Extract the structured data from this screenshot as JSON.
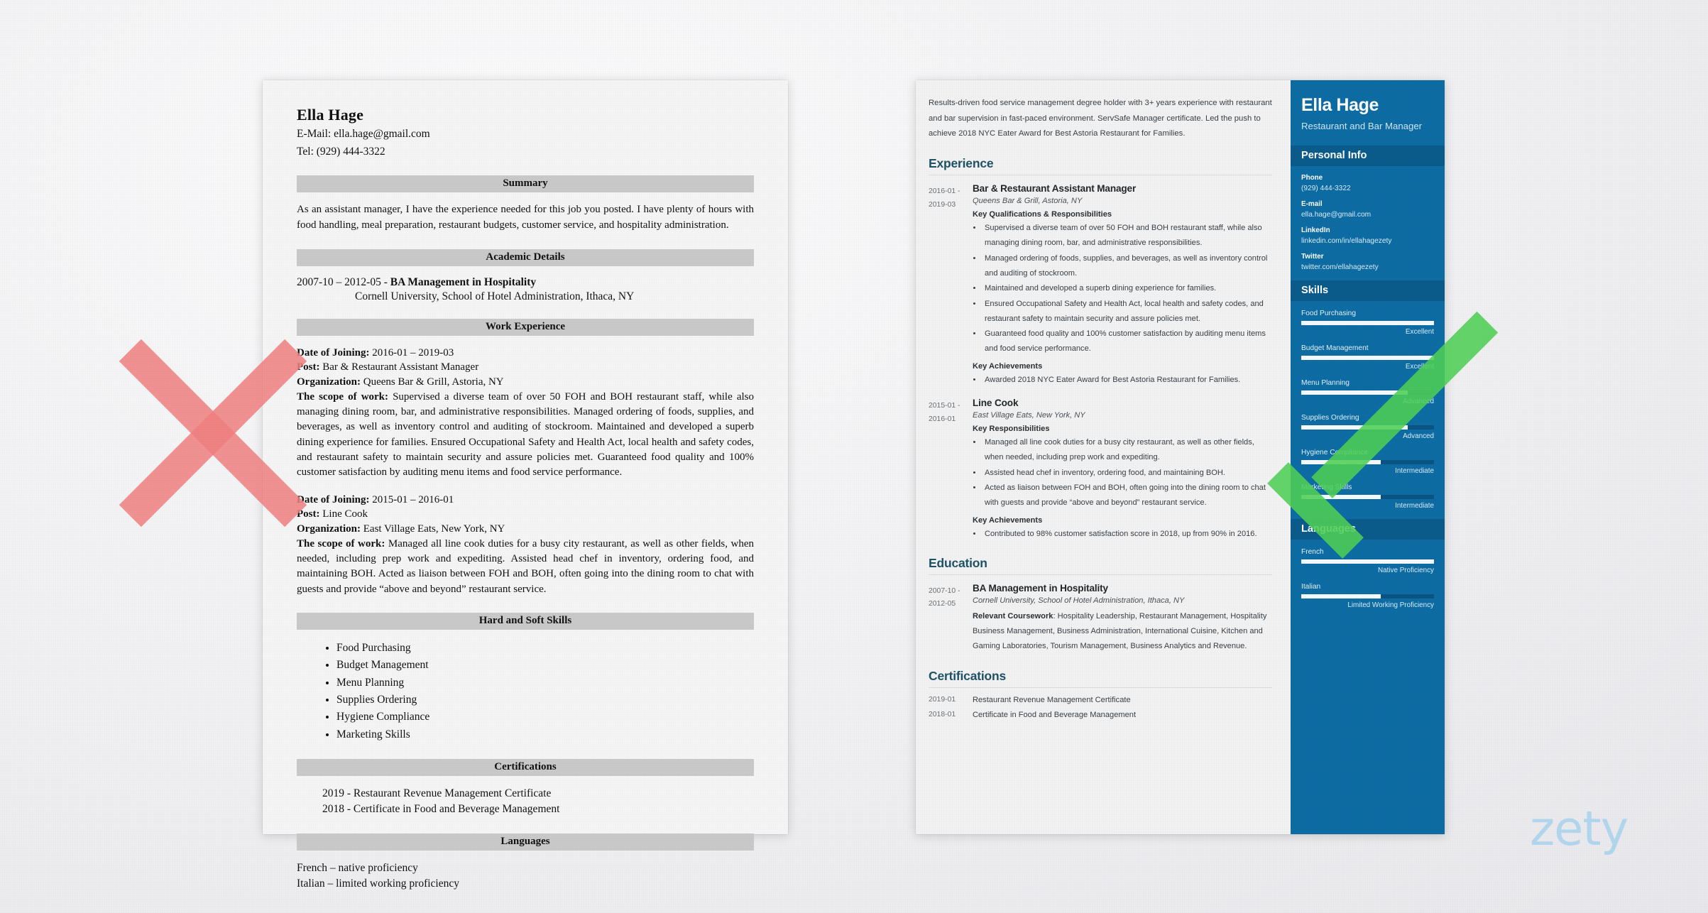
{
  "overlays": {
    "reject_mark": "x-cross-icon",
    "accept_mark": "check-mark-icon",
    "reject_color": "#F08080",
    "accept_color": "#4FCF55"
  },
  "branding": {
    "logo_text": "zety",
    "logo_color": "#AED5EF"
  },
  "bad_resume": {
    "name": "Ella Hage",
    "email_line": "E-Mail: ella.hage@gmail.com",
    "phone_line": "Tel: (929) 444-3322",
    "sections": {
      "summary_heading": "Summary",
      "summary_text": "As an assistant manager, I have the experience needed for this job you posted. I have plenty of hours with food handling, meal preparation, restaurant budgets, customer service, and hospitality administration.",
      "academic_heading": "Academic Details",
      "academic_dates": "2007-10 – 2012-05  - ",
      "academic_degree": "BA Management in Hospitality",
      "academic_school": "Cornell University, School of Hotel Administration, Ithaca, NY",
      "work_heading": "Work Experience",
      "skills_heading": "Hard and Soft Skills",
      "certs_heading": "Certifications",
      "langs_heading": "Languages"
    },
    "jobs": [
      {
        "date_label": "Date of Joining:",
        "date_value": "2016-01 – 2019-03",
        "post_label": "Post:",
        "post_value": "Bar & Restaurant Assistant Manager",
        "org_label": "Organization:",
        "org_value": "Queens Bar & Grill, Astoria, NY",
        "scope_label": "The scope of work:",
        "scope_value": "Supervised a diverse team of over 50 FOH and BOH restaurant staff, while also managing dining room, bar, and administrative responsibilities. Managed ordering of foods, supplies, and beverages, as well as inventory control and auditing of stockroom. Maintained and developed a superb dining experience for families. Ensured Occupational Safety and Health Act, local health and safety codes, and restaurant safety to maintain security and assure policies met. Guaranteed food quality and 100% customer satisfaction by auditing menu items and food service performance."
      },
      {
        "date_label": "Date of Joining:",
        "date_value": "2015-01 – 2016-01",
        "post_label": "Post:",
        "post_value": "Line Cook",
        "org_label": "Organization:",
        "org_value": "East Village Eats, New York, NY",
        "scope_label": "The scope of work:",
        "scope_value": "Managed all line cook duties for a busy city restaurant, as well as other fields, when needed, including prep work and expediting. Assisted head chef in inventory, ordering food, and maintaining BOH. Acted as liaison between FOH and BOH, often going into the dining room to chat with guests and provide “above and beyond” restaurant service."
      }
    ],
    "skills": [
      "Food Purchasing",
      "Budget Management",
      "Menu Planning",
      "Supplies Ordering",
      "Hygiene Compliance",
      "Marketing Skills"
    ],
    "certifications": [
      "2019 - Restaurant Revenue Management Certificate",
      "2018 - Certificate in Food and Beverage Management"
    ],
    "languages": [
      "French – native proficiency",
      "Italian – limited working proficiency"
    ]
  },
  "good_resume": {
    "summary": "Results-driven food service management degree holder with 3+ years experience with restaurant and bar supervision in fast-paced environment. ServSafe Manager certificate. Led the push to achieve 2018 NYC Eater Award for Best Astoria Restaurant for Families.",
    "experience_heading": "Experience",
    "education_heading": "Education",
    "certifications_heading": "Certifications",
    "experience": [
      {
        "dates": "2016-01 -\n2019-03",
        "date_from": "2016-01 -",
        "date_to": "2019-03",
        "role": "Bar & Restaurant Assistant Manager",
        "org": "Queens Bar & Grill, Astoria, NY",
        "sub1_label": "Key Qualifications & Responsibilities",
        "sub1_items": [
          "Supervised a diverse team of over 50 FOH and BOH restaurant staff, while also managing dining room, bar, and administrative responsibilities.",
          "Managed ordering of foods, supplies, and beverages, as well as inventory control and auditing of stockroom.",
          "Maintained and developed a superb dining experience for families.",
          "Ensured Occupational Safety and Health Act, local health and safety codes, and restaurant safety to maintain security and assure policies met.",
          "Guaranteed food quality and 100% customer satisfaction by auditing menu items and food service performance."
        ],
        "sub2_label": "Key Achievements",
        "sub2_items": [
          "Awarded 2018 NYC Eater Award for Best Astoria Restaurant for Families."
        ]
      },
      {
        "date_from": "2015-01 -",
        "date_to": "2016-01",
        "role": "Line Cook",
        "org": "East Village Eats, New York, NY",
        "sub1_label": "Key Responsibilities",
        "sub1_items": [
          "Managed all line cook duties for a busy city restaurant, as well as other fields, when needed, including prep work and expediting.",
          "Assisted head chef in inventory, ordering food, and maintaining BOH.",
          "Acted as liaison between FOH and BOH, often going into the dining room to chat with guests and provide “above and beyond” restaurant service."
        ],
        "sub2_label": "Key Achievements",
        "sub2_items": [
          "Contributed to 98% customer satisfaction score in 2018, up from 90% in 2016."
        ]
      }
    ],
    "education": {
      "date_from": "2007-10 -",
      "date_to": "2012-05",
      "degree": "BA Management in Hospitality",
      "school": "Cornell University, School of Hotel Administration, Ithaca, NY",
      "coursework_label": "Relevant Coursework",
      "coursework_text": ": Hospitality Leadership, Restaurant Management, Hospitality Business Management, Business Administration, International Cuisine, Kitchen and Gaming Laboratories, Tourism Management, Business Analytics and Revenue."
    },
    "certifications": [
      {
        "date": "2019-01",
        "title": "Restaurant Revenue Management Certificate"
      },
      {
        "date": "2018-01",
        "title": "Certificate in Food and Beverage Management"
      }
    ],
    "sidebar": {
      "name": "Ella Hage",
      "job_title": "Restaurant and Bar Manager",
      "personal_info_heading": "Personal Info",
      "contacts": [
        {
          "label": "Phone",
          "value": "(929) 444-3322"
        },
        {
          "label": "E-mail",
          "value": "ella.hage@gmail.com"
        },
        {
          "label": "LinkedIn",
          "value": "linkedin.com/in/ellahagezety"
        },
        {
          "label": "Twitter",
          "value": "twitter.com/ellahagezety"
        }
      ],
      "skills_heading": "Skills",
      "skills": [
        {
          "name": "Food Purchasing",
          "level": "Excellent",
          "pct": 100
        },
        {
          "name": "Budget Management",
          "level": "Excellent",
          "pct": 100
        },
        {
          "name": "Menu Planning",
          "level": "Advanced",
          "pct": 80
        },
        {
          "name": "Supplies Ordering",
          "level": "Advanced",
          "pct": 80
        },
        {
          "name": "Hygiene Compliance",
          "level": "Intermediate",
          "pct": 60
        },
        {
          "name": "Marketing Skills",
          "level": "Intermediate",
          "pct": 60
        }
      ],
      "languages_heading": "Languages",
      "languages": [
        {
          "name": "French",
          "level": "Native Proficiency",
          "pct": 100
        },
        {
          "name": "Italian",
          "level": "Limited Working Proficiency",
          "pct": 60
        }
      ],
      "bg_color": "#0D6CA4",
      "band_color": "#0A5B8C"
    }
  }
}
